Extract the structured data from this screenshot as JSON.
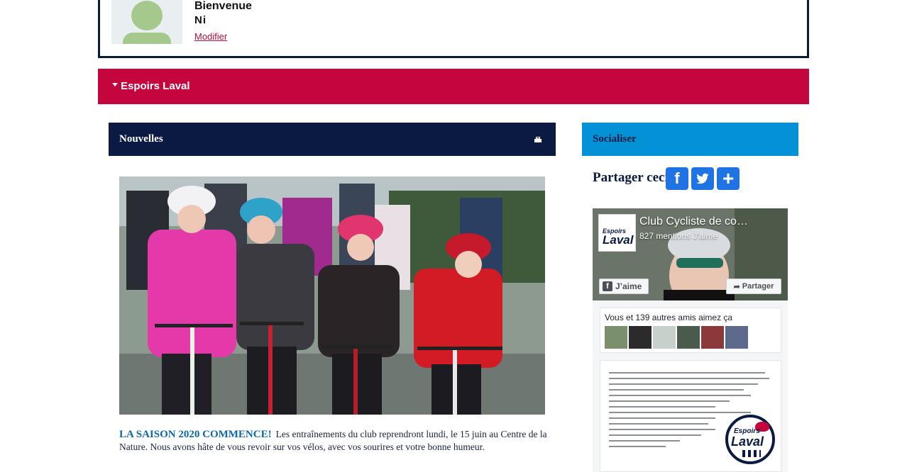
{
  "user": {
    "welcome": "Bienvenue",
    "name": "Ni",
    "edit_link": "Modifier"
  },
  "nav": {
    "items": [
      {
        "label": "Espoirs Laval"
      }
    ]
  },
  "news": {
    "header": "Nouvelles",
    "print_icon": "printer-icon",
    "headline": "LA SAISON 2020 COMMENCE!",
    "body": "Les entraînements du club reprendront lundi, le 15 juin au Centre de la Nature. Nous avons hâte de vous revoir sur vos vélos, avec vos sourires et votre bonne humeur."
  },
  "social": {
    "header": "Socialiser",
    "share_label": "Partager ceci",
    "share_buttons": [
      {
        "icon": "facebook-icon",
        "glyph": "f"
      },
      {
        "icon": "twitter-icon",
        "glyph": "t"
      },
      {
        "icon": "plus-icon",
        "glyph": "+"
      }
    ]
  },
  "facebook_widget": {
    "page_name": "Club Cycliste de co…",
    "likes": "827 mentions J’aime",
    "like_button": "J’aime",
    "share_button": "Partager",
    "friends_text": "Vous et 139 autres amis aimez ça",
    "logo_line1": "Espoirs",
    "logo_line2": "Laval"
  },
  "colors": {
    "nav_red": "#c4063d",
    "navy": "#0a1a43",
    "social_blue": "#0392d6",
    "share_blue": "#1f73e3",
    "headline_blue": "#0b67a9"
  }
}
